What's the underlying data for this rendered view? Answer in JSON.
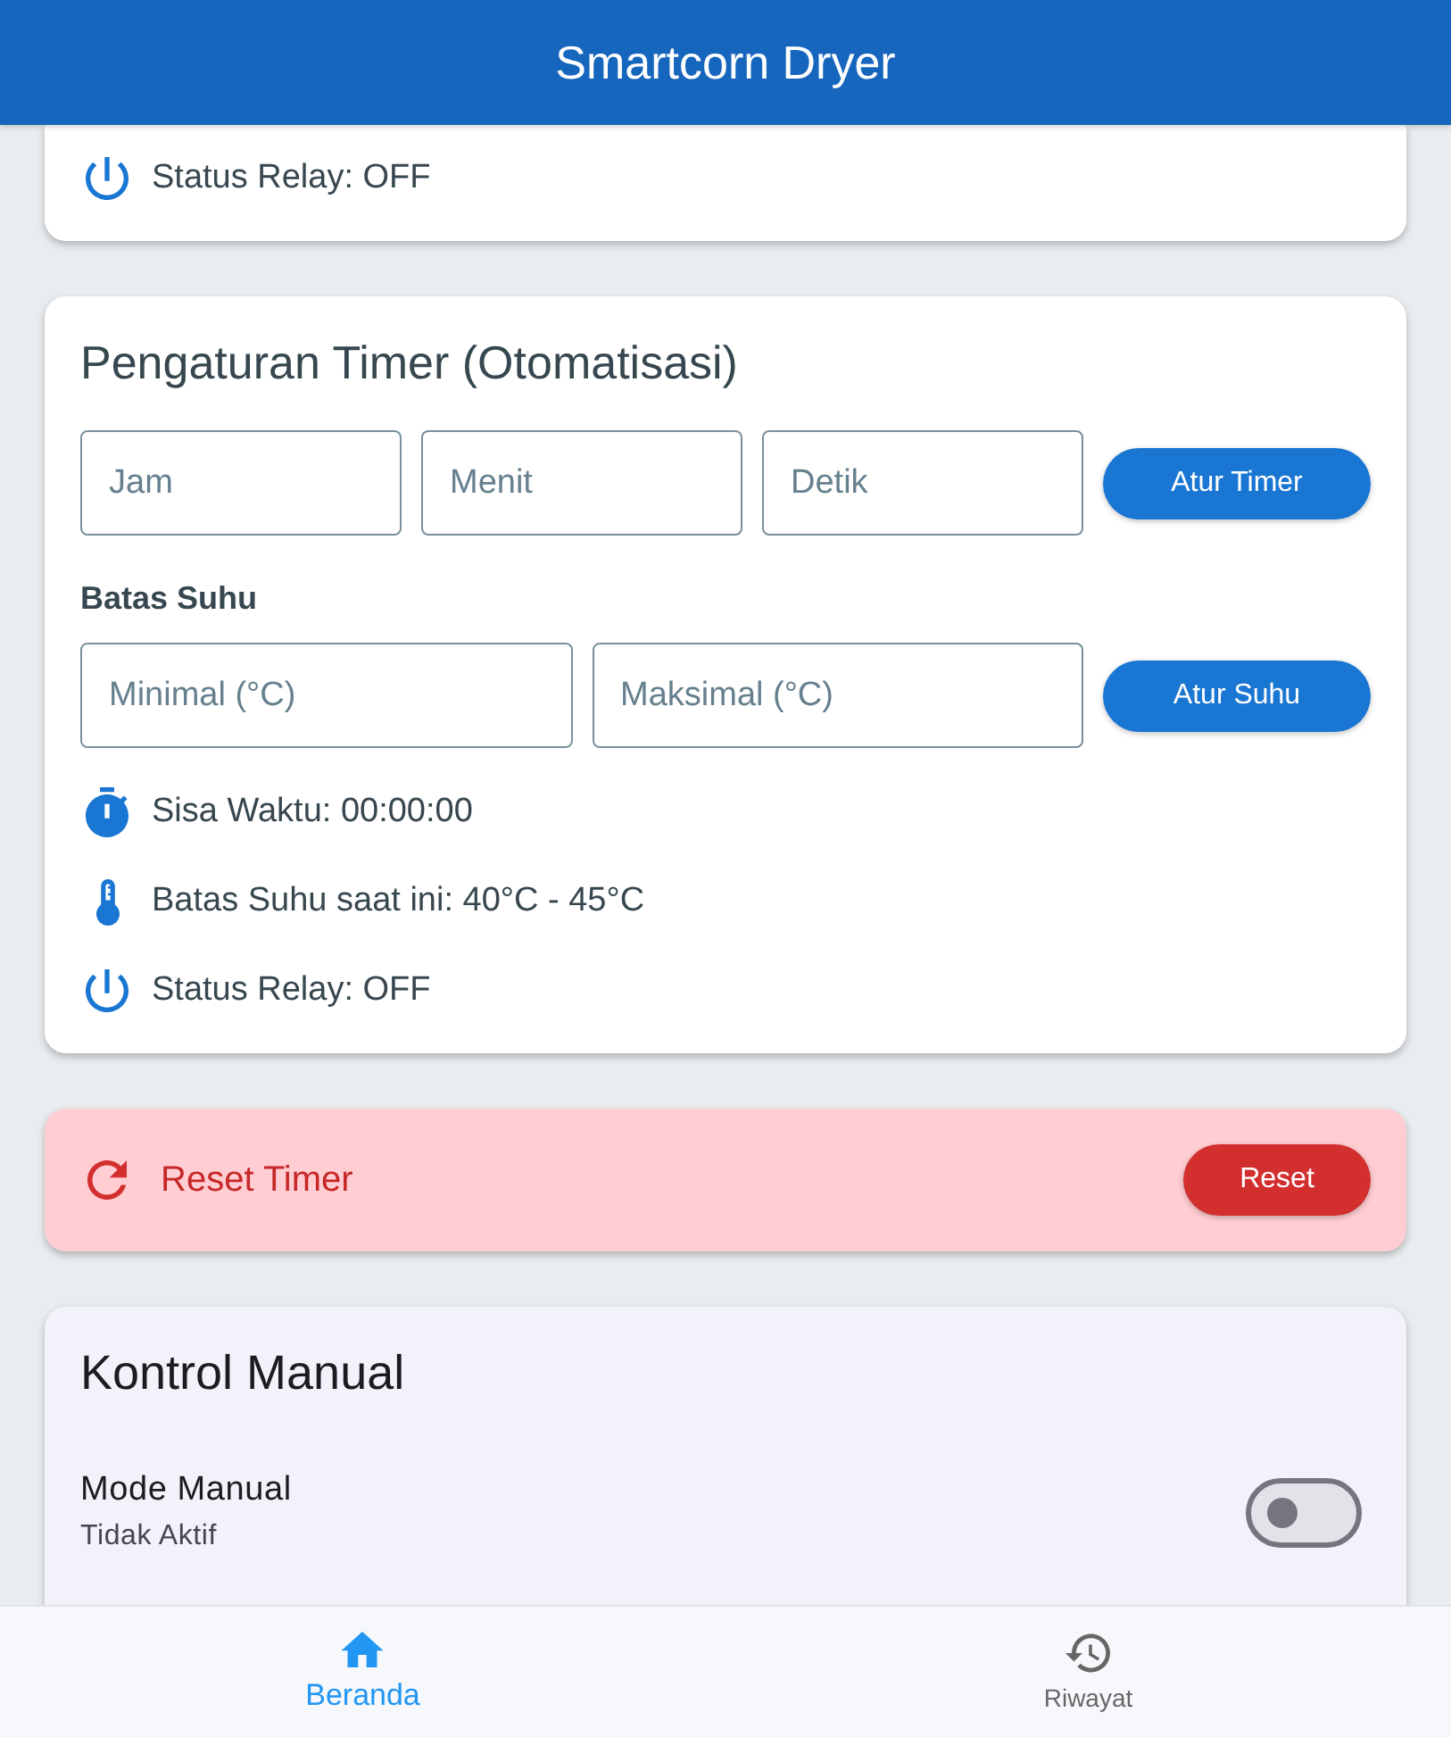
{
  "app_bar": {
    "title": "Smartcorn Dryer"
  },
  "status_card": {
    "rows": [
      {
        "kind": "power",
        "text": "Status Relay: OFF"
      }
    ]
  },
  "timer_card": {
    "title": "Pengaturan Timer (Otomatisasi)",
    "timer_fields": [
      {
        "placeholder": "Jam"
      },
      {
        "placeholder": "Menit"
      },
      {
        "placeholder": "Detik"
      }
    ],
    "timer_button": "Atur Timer",
    "temp_label": "Batas Suhu",
    "temp_fields": [
      {
        "placeholder": "Minimal (°C)"
      },
      {
        "placeholder": "Maksimal (°C)"
      }
    ],
    "temp_button": "Atur Suhu",
    "rows": [
      {
        "kind": "timer",
        "text": "Sisa Waktu: 00:00:00"
      },
      {
        "kind": "thermometer",
        "text": "Batas Suhu saat ini: 40°C - 45°C"
      },
      {
        "kind": "power",
        "text": "Status Relay: OFF"
      }
    ]
  },
  "reset_card": {
    "label": "Reset Timer",
    "button": "Reset"
  },
  "manual_card": {
    "title": "Kontrol Manual",
    "label": "Mode Manual",
    "status": "Tidak Aktif",
    "on": false
  },
  "bottom_nav": [
    {
      "kind": "home",
      "label": "Beranda",
      "selected": true
    },
    {
      "kind": "history",
      "label": "Riwayat",
      "selected": false
    }
  ]
}
